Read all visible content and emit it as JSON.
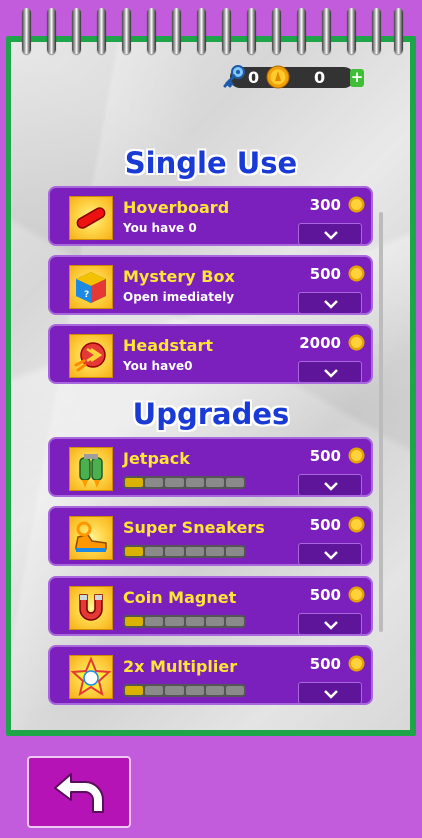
{
  "currency": {
    "keys": "0",
    "coins": "0",
    "add_label": "+"
  },
  "single_use": {
    "title": "Single Use",
    "items": [
      {
        "name": "Hoverboard",
        "sub": "You have 0",
        "price": "300",
        "icon": "hoverboard-icon"
      },
      {
        "name": "Mystery Box",
        "sub": "Open imediately",
        "price": "500",
        "icon": "mystery-box-icon"
      },
      {
        "name": "Headstart",
        "sub": "You have0",
        "price": "2000",
        "icon": "headstart-rocket-icon"
      }
    ]
  },
  "upgrades": {
    "title": "Upgrades",
    "items": [
      {
        "name": "Jetpack",
        "price": "500",
        "level": 0,
        "max_level": 6,
        "icon": "jetpack-icon"
      },
      {
        "name": "Super Sneakers",
        "price": "500",
        "level": 0,
        "max_level": 6,
        "icon": "sneakers-icon"
      },
      {
        "name": "Coin Magnet",
        "price": "500",
        "level": 0,
        "max_level": 6,
        "icon": "magnet-icon"
      },
      {
        "name": "2x Multiplier",
        "price": "500",
        "level": 0,
        "max_level": 6,
        "icon": "multiplier-star-icon"
      }
    ]
  },
  "colors": {
    "background": "#c35cdc",
    "notebook_border": "#1ea54a",
    "card": "#7b1fbd",
    "title_blue": "#1a3ad6",
    "item_name": "#ffe634"
  }
}
